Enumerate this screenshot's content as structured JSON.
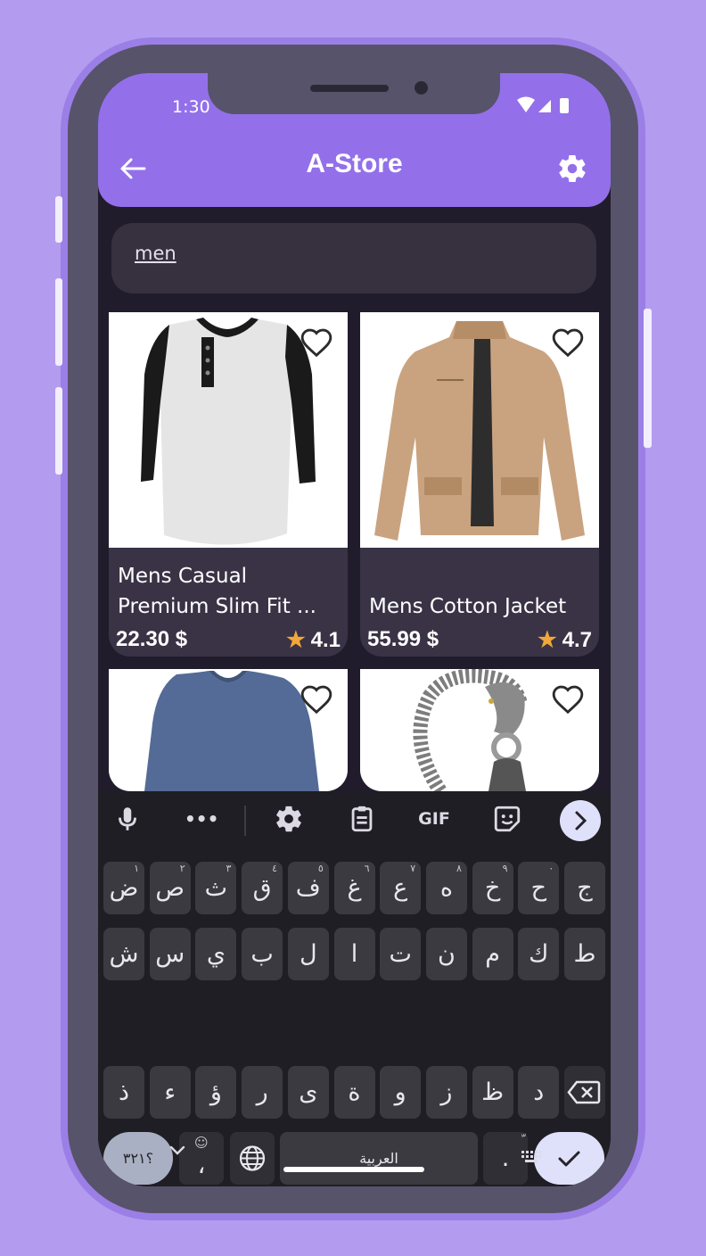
{
  "status_bar": {
    "time": "1:30"
  },
  "app_bar": {
    "title": "A-Store",
    "back_icon": "back-arrow-icon",
    "settings_icon": "gear-icon"
  },
  "search": {
    "value": "men"
  },
  "products": [
    {
      "title_line1": "Mens Casual",
      "title_line2": "Premium Slim Fit ...",
      "price": "22.30 $",
      "rating": "4.1"
    },
    {
      "title_line1": "",
      "title_line2": "Mens Cotton Jacket",
      "price": "55.99 $",
      "rating": "4.7"
    },
    {
      "title_line1": "",
      "title_line2": "",
      "price": "",
      "rating": ""
    },
    {
      "title_line1": "",
      "title_line2": "",
      "price": "",
      "rating": ""
    }
  ],
  "keyboard": {
    "toolbar": [
      "mic-icon",
      "more-icon",
      "gear-icon",
      "clipboard-icon",
      "GIF",
      "sticker-icon",
      "chevron-right-icon"
    ],
    "gif_label": "GIF",
    "row1": [
      {
        "k": "ض",
        "h": "١"
      },
      {
        "k": "ص",
        "h": "٢"
      },
      {
        "k": "ث",
        "h": "٣"
      },
      {
        "k": "ق",
        "h": "٤"
      },
      {
        "k": "ف",
        "h": "٥"
      },
      {
        "k": "غ",
        "h": "٦"
      },
      {
        "k": "ع",
        "h": "٧"
      },
      {
        "k": "ه",
        "h": "٨"
      },
      {
        "k": "خ",
        "h": "٩"
      },
      {
        "k": "ح",
        "h": "٠"
      },
      {
        "k": "ج",
        "h": ""
      }
    ],
    "row2": [
      "ش",
      "س",
      "ي",
      "ب",
      "ل",
      "ا",
      "ت",
      "ن",
      "م",
      "ك",
      "ط"
    ],
    "row3": [
      "ذ",
      "ء",
      "ؤ",
      "ر",
      "ى",
      "ة",
      "و",
      "ز",
      "ظ",
      "د"
    ],
    "symbols_key": "؟٣٢١",
    "emoji_comma_key": "،",
    "space_label": "العربية",
    "period_key": ".",
    "period_hint": "ّ"
  },
  "colors": {
    "accent": "#9370ea",
    "background": "#b39cf0",
    "star": "#f1a73a"
  }
}
